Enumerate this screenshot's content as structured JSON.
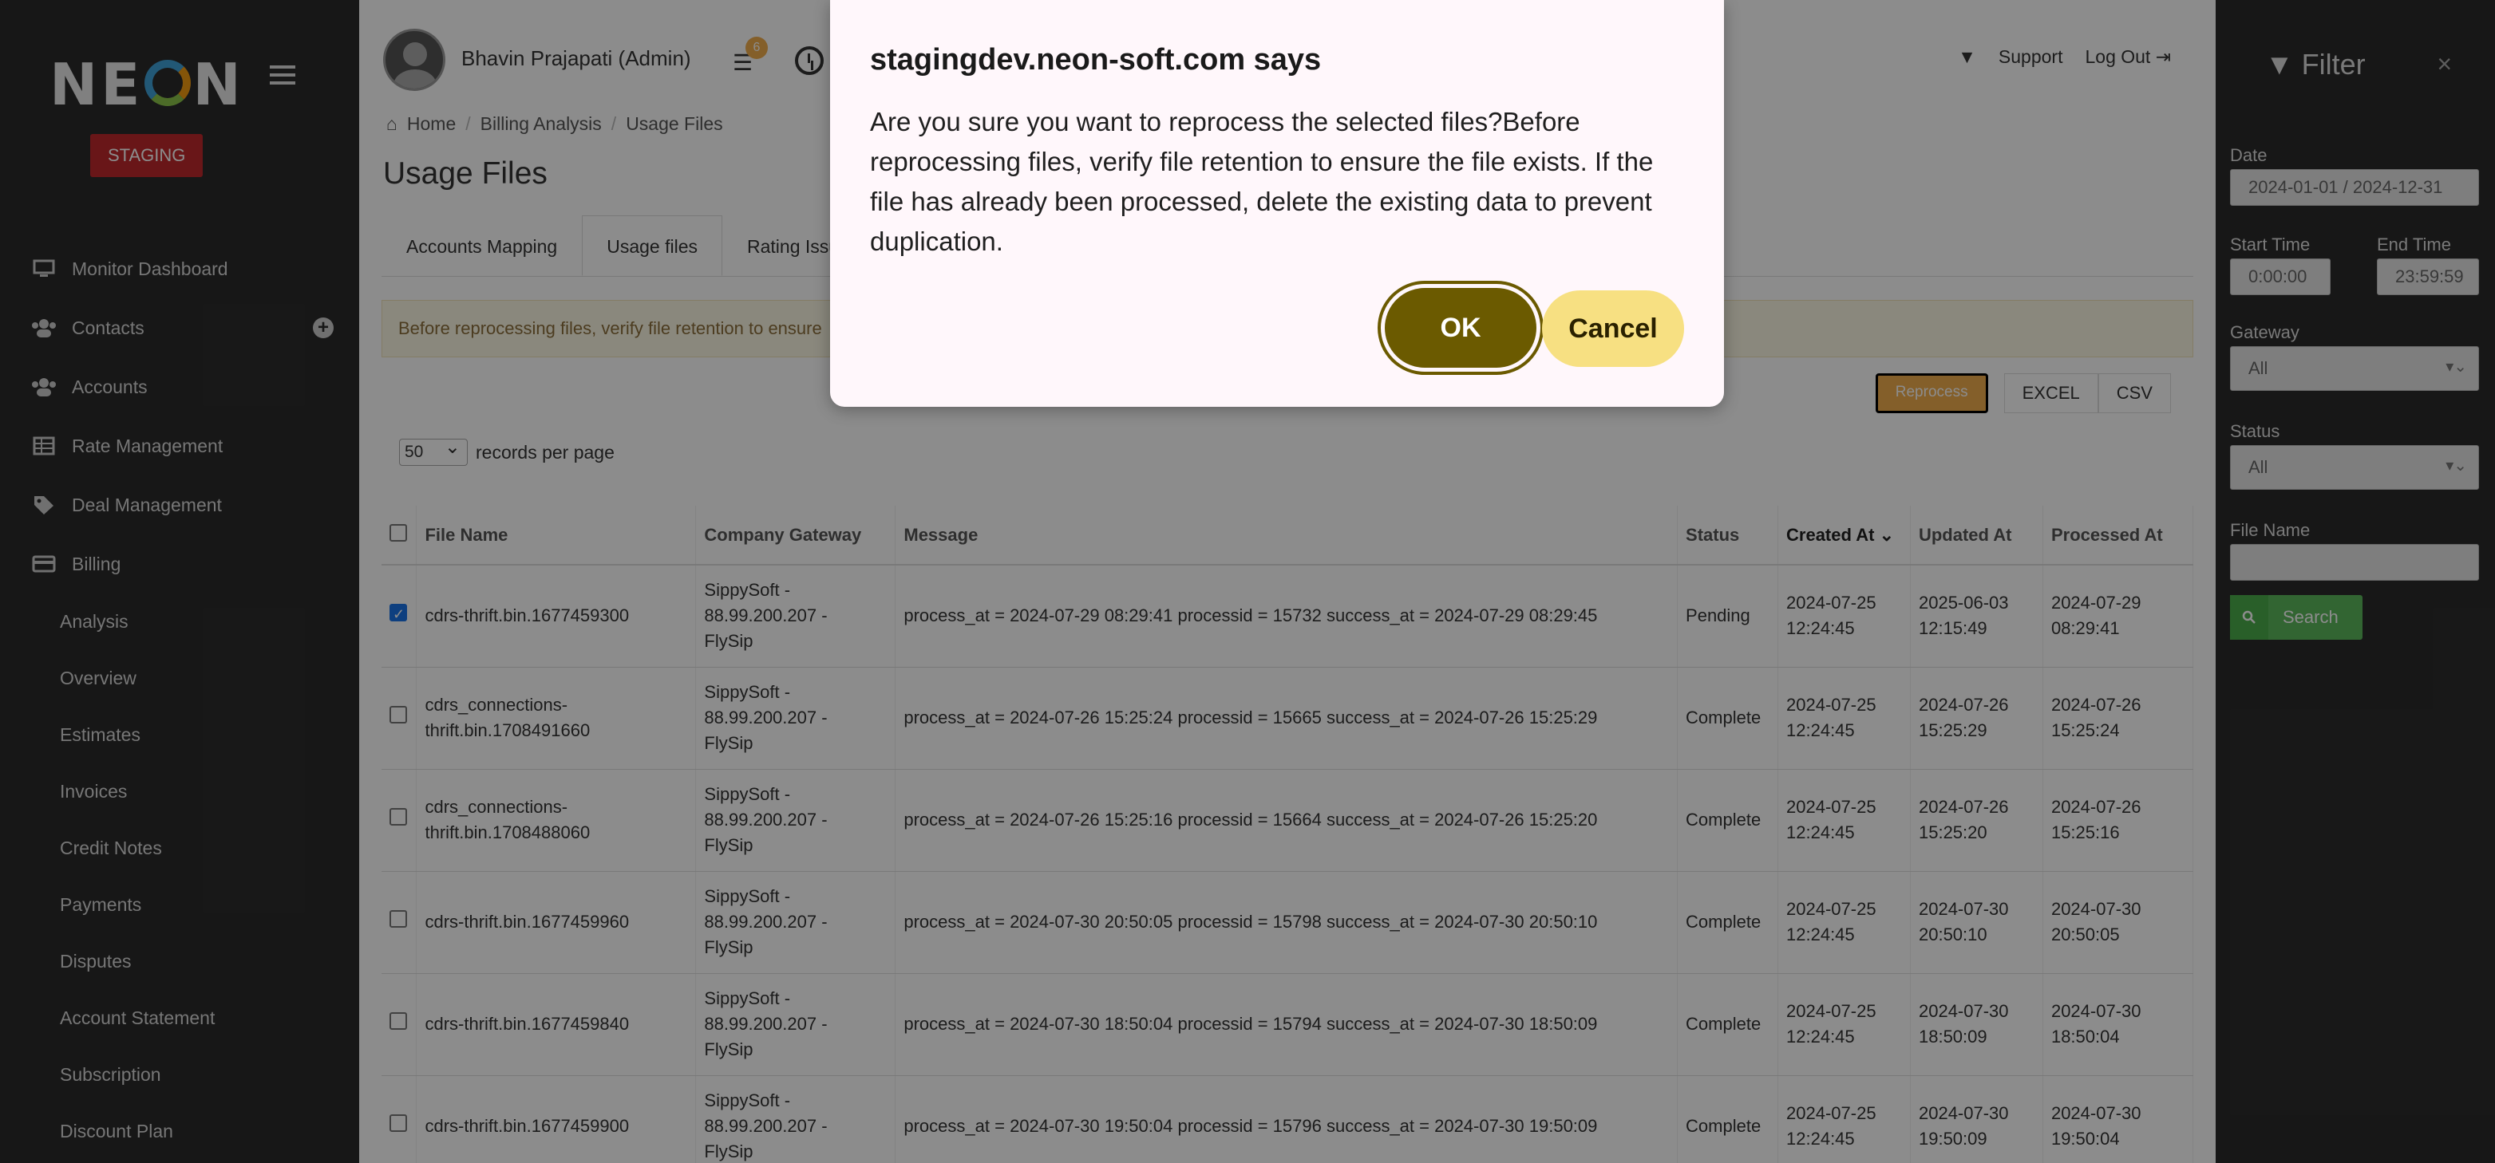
{
  "sidebar": {
    "logo_left": "NE",
    "logo_right": "N",
    "env_badge": "STAGING",
    "items": [
      {
        "label": "Monitor Dashboard",
        "icon": "monitor-icon"
      },
      {
        "label": "Contacts",
        "icon": "users-icon"
      },
      {
        "label": "Accounts",
        "icon": "users-icon"
      },
      {
        "label": "Rate Management",
        "icon": "table-icon"
      },
      {
        "label": "Deal Management",
        "icon": "tag-icon"
      },
      {
        "label": "Billing",
        "icon": "credit-card-icon"
      }
    ],
    "billing_sub": [
      "Analysis",
      "Overview",
      "Estimates",
      "Invoices",
      "Credit Notes",
      "Payments",
      "Disputes",
      "Account Statement",
      "Subscription",
      "Discount Plan"
    ]
  },
  "header": {
    "username": "Bhavin Prajapati (Admin)",
    "notif_count": "6",
    "support": "Support",
    "logout": "Log Out"
  },
  "breadcrumb": [
    "Home",
    "Billing Analysis",
    "Usage Files"
  ],
  "page_title": "Usage Files",
  "tabs": [
    "Accounts Mapping",
    "Usage files",
    "Rating Issu"
  ],
  "alert": "Before reprocessing files, verify file retention to ensure",
  "actions": {
    "reprocess": "Reprocess",
    "excel": "EXCEL",
    "csv": "CSV"
  },
  "per_page": {
    "value": "50",
    "label": "records per page"
  },
  "table": {
    "columns": [
      "File Name",
      "Company Gateway",
      "Message",
      "Status",
      "Created At",
      "Updated At",
      "Processed At"
    ],
    "rows": [
      {
        "checked": true,
        "file": "cdrs-thrift.bin.1677459300",
        "gw1": "SippySoft -",
        "gw2": "88.99.200.207 -",
        "gw3": "FlySip",
        "message": "process_at = 2024-07-29 08:29:41 processid = 15732 success_at = 2024-07-29 08:29:45",
        "status": "Pending",
        "created1": "2024-07-25",
        "created2": "12:24:45",
        "updated1": "2025-06-03",
        "updated2": "12:15:49",
        "processed1": "2024-07-29",
        "processed2": "08:29:41"
      },
      {
        "checked": false,
        "file": "cdrs_connections-thrift.bin.1708491660",
        "gw1": "SippySoft -",
        "gw2": "88.99.200.207 -",
        "gw3": "FlySip",
        "message": "process_at = 2024-07-26 15:25:24 processid = 15665 success_at = 2024-07-26 15:25:29",
        "status": "Complete",
        "created1": "2024-07-25",
        "created2": "12:24:45",
        "updated1": "2024-07-26",
        "updated2": "15:25:29",
        "processed1": "2024-07-26",
        "processed2": "15:25:24"
      },
      {
        "checked": false,
        "file": "cdrs_connections-thrift.bin.1708488060",
        "gw1": "SippySoft -",
        "gw2": "88.99.200.207 -",
        "gw3": "FlySip",
        "message": "process_at = 2024-07-26 15:25:16 processid = 15664 success_at = 2024-07-26 15:25:20",
        "status": "Complete",
        "created1": "2024-07-25",
        "created2": "12:24:45",
        "updated1": "2024-07-26",
        "updated2": "15:25:20",
        "processed1": "2024-07-26",
        "processed2": "15:25:16"
      },
      {
        "checked": false,
        "file": "cdrs-thrift.bin.1677459960",
        "gw1": "SippySoft -",
        "gw2": "88.99.200.207 -",
        "gw3": "FlySip",
        "message": "process_at = 2024-07-30 20:50:05 processid = 15798 success_at = 2024-07-30 20:50:10",
        "status": "Complete",
        "created1": "2024-07-25",
        "created2": "12:24:45",
        "updated1": "2024-07-30",
        "updated2": "20:50:10",
        "processed1": "2024-07-30",
        "processed2": "20:50:05"
      },
      {
        "checked": false,
        "file": "cdrs-thrift.bin.1677459840",
        "gw1": "SippySoft -",
        "gw2": "88.99.200.207 -",
        "gw3": "FlySip",
        "message": "process_at = 2024-07-30 18:50:04 processid = 15794 success_at = 2024-07-30 18:50:09",
        "status": "Complete",
        "created1": "2024-07-25",
        "created2": "12:24:45",
        "updated1": "2024-07-30",
        "updated2": "18:50:09",
        "processed1": "2024-07-30",
        "processed2": "18:50:04"
      },
      {
        "checked": false,
        "file": "cdrs-thrift.bin.1677459900",
        "gw1": "SippySoft -",
        "gw2": "88.99.200.207 -",
        "gw3": "FlySip",
        "message": "process_at = 2024-07-30 19:50:04 processid = 15796 success_at = 2024-07-30 19:50:09",
        "status": "Complete",
        "created1": "2024-07-25",
        "created2": "12:24:45",
        "updated1": "2024-07-30",
        "updated2": "19:50:09",
        "processed1": "2024-07-30",
        "processed2": "19:50:04"
      }
    ]
  },
  "filter": {
    "title": "Filter",
    "close": "×",
    "date_label": "Date",
    "date_value": "2024-01-01 / 2024-12-31",
    "start_label": "Start Time",
    "start_value": "0:00:00",
    "end_label": "End Time",
    "end_value": "23:59:59",
    "gateway_label": "Gateway",
    "gateway_value": "All",
    "status_label": "Status",
    "status_value": "All",
    "file_label": "File Name",
    "file_value": "",
    "search": "Search"
  },
  "dialog": {
    "title": "stagingdev.neon-soft.com says",
    "message": "Are you sure you want to reprocess the selected files?Before reprocessing files, verify file retention to ensure the file exists. If the file has already been processed, delete the existing data to prevent duplication.",
    "ok": "OK",
    "cancel": "Cancel"
  },
  "colors": {
    "sidebar_bg": "#2b2b2b",
    "staging_red": "#c0282d",
    "reprocess_orange": "#f0ad4e",
    "ok_olive": "#6b5a00",
    "cancel_yellow": "#f7e082",
    "search_green": "#5cb85c"
  }
}
